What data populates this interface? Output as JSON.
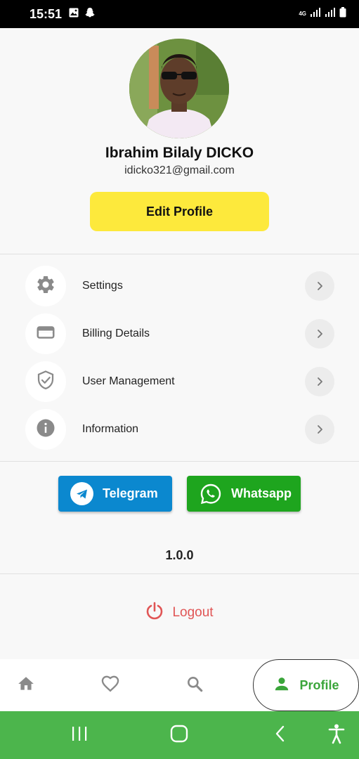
{
  "status_bar": {
    "time": "15:51",
    "network_label": "4G",
    "icons": [
      "gallery-icon",
      "snapchat-icon",
      "signal-icon",
      "signal-icon",
      "battery-icon"
    ]
  },
  "profile": {
    "name": "Ibrahim Bilaly DICKO",
    "email": "idicko321@gmail.com",
    "edit_button_label": "Edit Profile"
  },
  "menu": {
    "items": [
      {
        "label": "Settings",
        "icon": "gear-icon"
      },
      {
        "label": "Billing Details",
        "icon": "wallet-icon"
      },
      {
        "label": "User Management",
        "icon": "shield-check-icon"
      },
      {
        "label": "Information",
        "icon": "info-icon"
      }
    ]
  },
  "social": {
    "telegram_label": "Telegram",
    "whatsapp_label": "Whatsapp"
  },
  "version": "1.0.0",
  "logout_label": "Logout",
  "bottom_nav": {
    "items": [
      {
        "icon": "home-icon"
      },
      {
        "icon": "heart-icon"
      },
      {
        "icon": "search-icon"
      },
      {
        "icon": "person-icon",
        "label": "Profile",
        "active": true
      }
    ]
  },
  "colors": {
    "accent_yellow": "#fde93c",
    "telegram_blue": "#0b88cf",
    "whatsapp_green": "#1ea51e",
    "active_green": "#3aa53a",
    "logout_red": "#e05555",
    "system_nav_green": "#4cb54c"
  }
}
